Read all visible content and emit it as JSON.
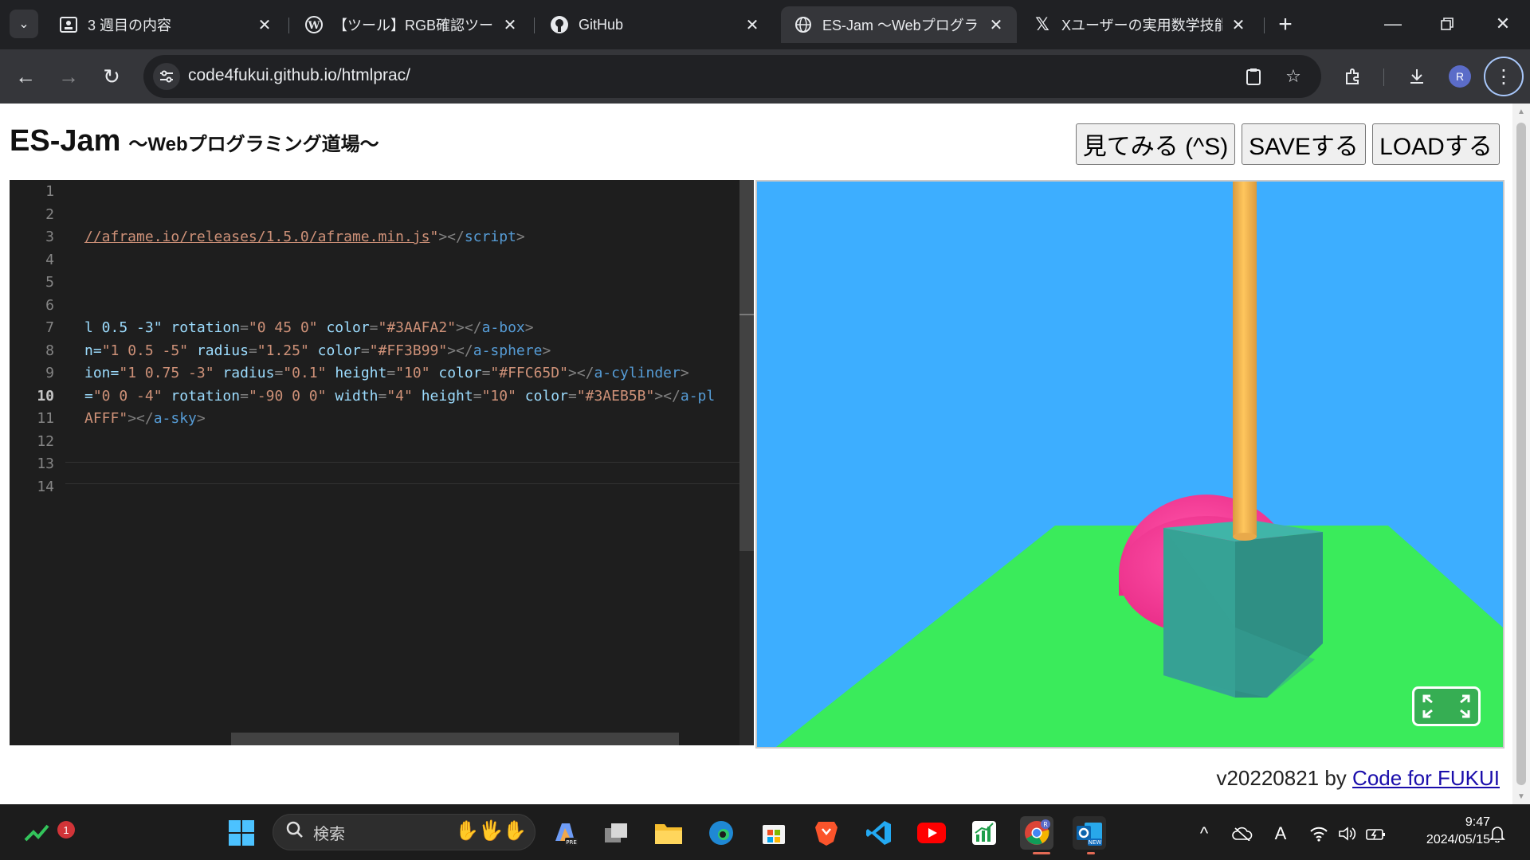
{
  "browser": {
    "tabs": [
      {
        "title": "3 週目の内容",
        "icon": "classroom-icon"
      },
      {
        "title": "【ツール】RGB確認ツール – N",
        "icon": "wordpress-icon"
      },
      {
        "title": "GitHub",
        "icon": "github-icon"
      },
      {
        "title": "ES-Jam 〜Webプログラミン",
        "icon": "globe-icon",
        "active": true
      },
      {
        "title": "Xユーザーの実用数学技能検",
        "icon": "x-icon"
      }
    ],
    "url": "code4fukui.github.io/htmlprac/"
  },
  "page": {
    "title": "ES-Jam",
    "subtitle": "〜Webプログラミング道場〜",
    "buttons": {
      "view": "見てみる (^S)",
      "save": "SAVEする",
      "load": "LOADする"
    },
    "footer": {
      "version": "v20220821 by",
      "link": "Code for FUKUI"
    }
  },
  "editor": {
    "line_numbers": [
      "1",
      "2",
      "3",
      "4",
      "5",
      "6",
      "7",
      "8",
      "9",
      "10",
      "11",
      "12",
      "13",
      "14"
    ],
    "current_line": "10"
  },
  "scene_colors": {
    "sky": "#3DAEFF",
    "plane": "#3AEB5B",
    "box": "#3AAFA2",
    "sphere": "#FF3B99",
    "cylinder": "#FFC65D"
  },
  "taskbar": {
    "search_label": "検索",
    "widget_badge": "1",
    "time": "9:47",
    "date": "2024/05/15",
    "ime": "A"
  }
}
